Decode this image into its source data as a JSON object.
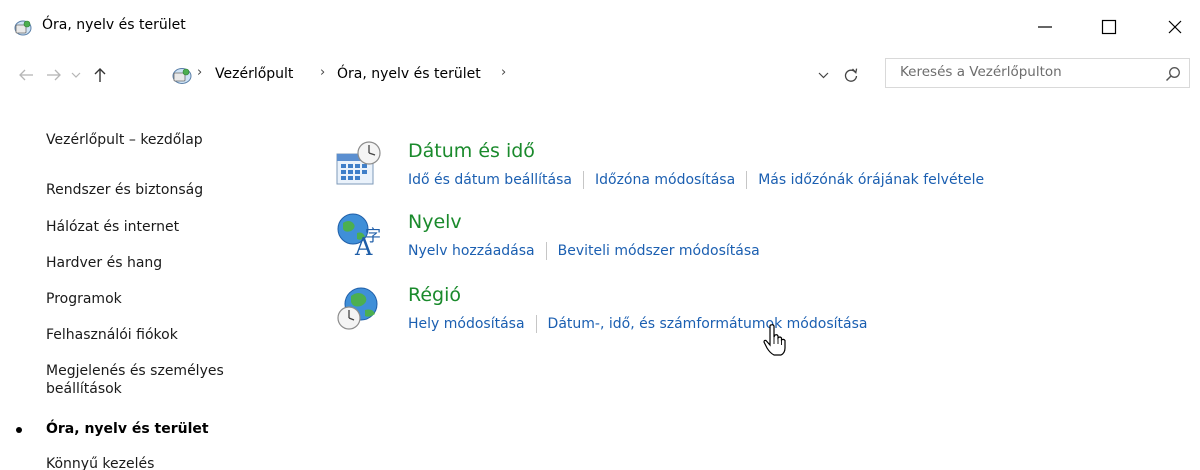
{
  "window": {
    "title": "Óra, nyelv és terület",
    "minimize_glyph": "—",
    "maximize_glyph": "☐",
    "close_glyph": "✕"
  },
  "nav": {
    "breadcrumb": [
      "Vezérlőpult",
      "Óra, nyelv és terület"
    ],
    "search_placeholder": "Keresés a Vezérlőpulton"
  },
  "sidebar": {
    "items": [
      {
        "label": "Vezérlőpult – kezdőlap"
      },
      {
        "label": "Rendszer és biztonság"
      },
      {
        "label": "Hálózat és internet"
      },
      {
        "label": "Hardver és hang"
      },
      {
        "label": "Programok"
      },
      {
        "label": "Felhasználói fiókok"
      },
      {
        "label": "Megjelenés és személyes beállítások"
      },
      {
        "label": "Óra, nyelv és terület",
        "active": true
      },
      {
        "label": "Könnyű kezelés"
      }
    ]
  },
  "categories": [
    {
      "title": "Dátum és idő",
      "icon": "calendar-clock-icon",
      "links": [
        "Idő és dátum beállítása",
        "Időzóna módosítása",
        "Más időzónák órájának felvétele"
      ]
    },
    {
      "title": "Nyelv",
      "icon": "language-globe-icon",
      "links": [
        "Nyelv hozzáadása",
        "Beviteli módszer módosítása"
      ]
    },
    {
      "title": "Régió",
      "icon": "region-globe-clock-icon",
      "links": [
        "Hely módosítása",
        "Dátum-, idő, és számformátumok módosítása"
      ]
    }
  ],
  "colors": {
    "category_title": "#1a8a2c",
    "link": "#1b5fb1",
    "text": "#1a1a1a"
  }
}
